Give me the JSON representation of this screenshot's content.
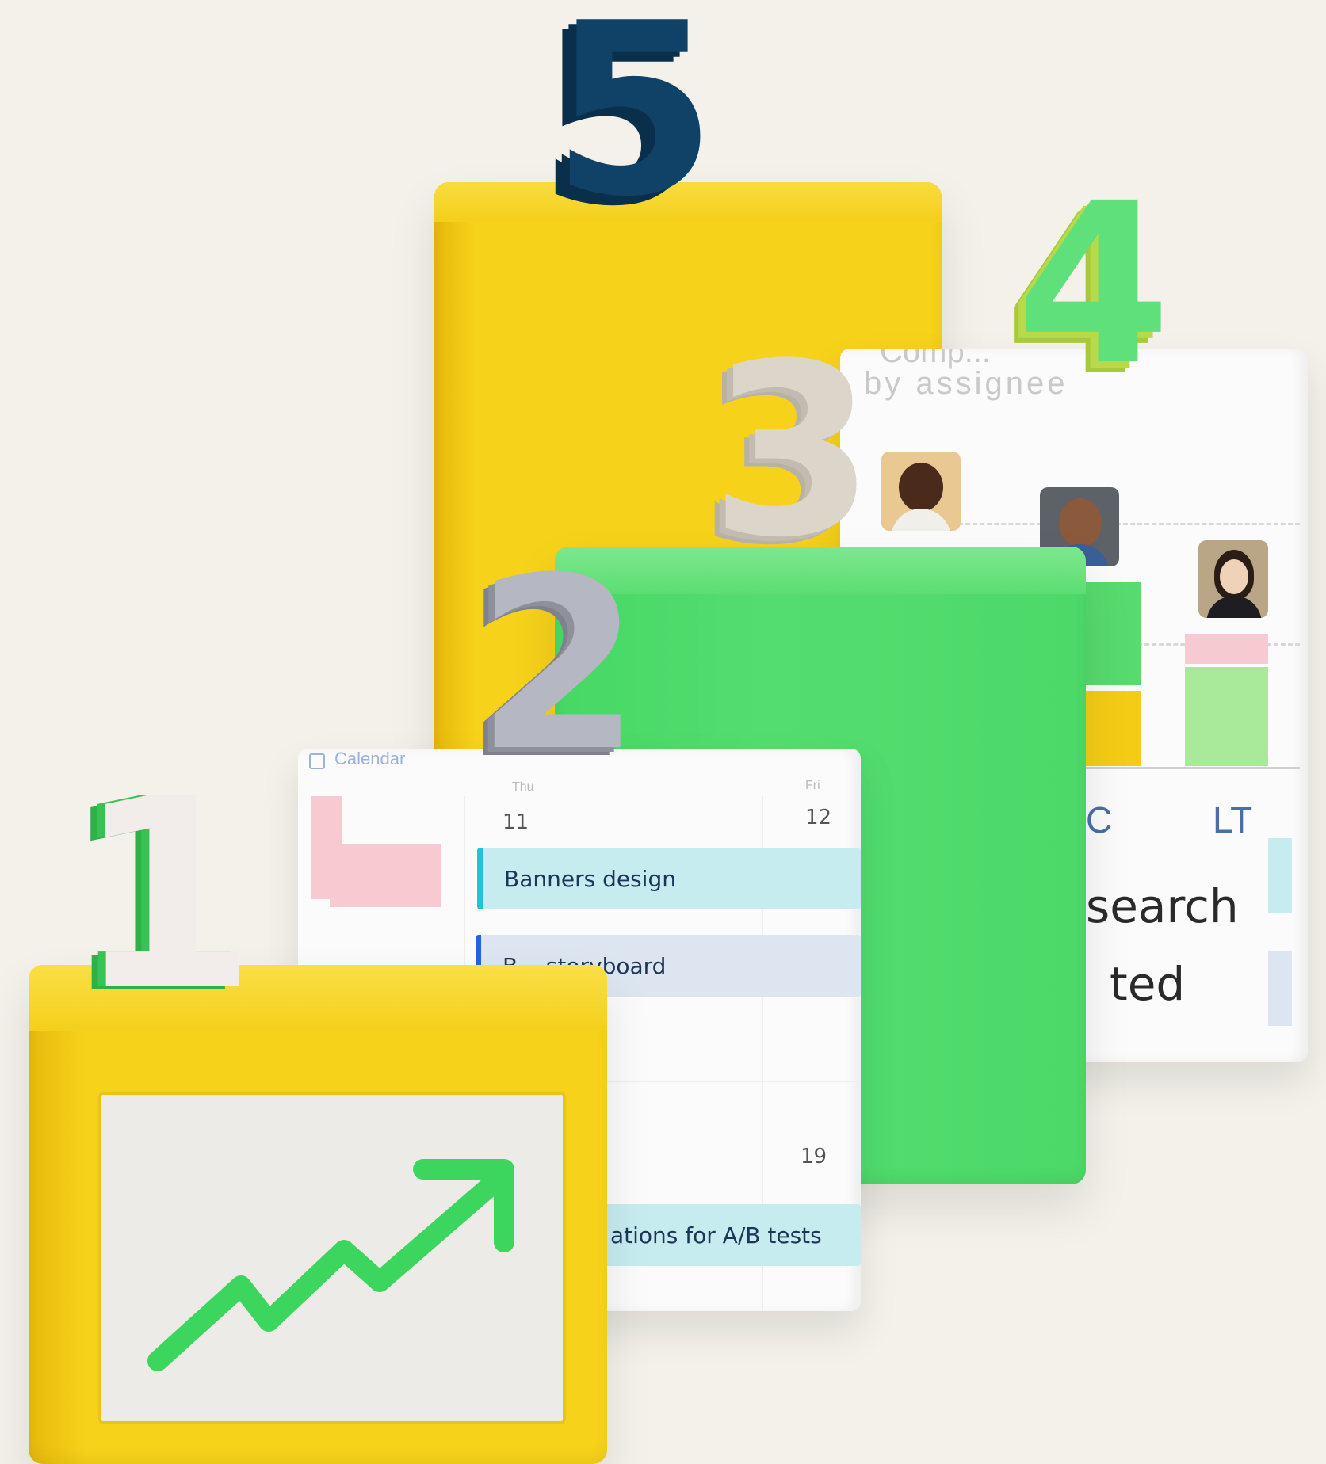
{
  "scene": {
    "background": "#f3f1ea",
    "digits": {
      "one": "1",
      "two": "2",
      "three": "3",
      "four": "4",
      "five": "5"
    },
    "colors": {
      "yellow": "#f4cc16",
      "green": "#4fdc6b",
      "navy": "#0f4266",
      "silver": "#a8aab5",
      "stone": "#dcd6ca",
      "mint": "#6fe07a"
    }
  },
  "calendar": {
    "title": "Calendar",
    "day_headers": [
      "Thu",
      "Fri"
    ],
    "dates": [
      "11",
      "12",
      "19"
    ],
    "events": [
      {
        "label": "Banners design",
        "color": "#c6ecef",
        "accent": "#22c3d6"
      },
      {
        "label": "Banner storyboard",
        "visible_label": "B... storyboard",
        "color": "#dde6f0",
        "accent": "#2463d9"
      },
      {
        "label": "ations for A/B tests",
        "color": "#c6ecef",
        "accent": "#22c3d6"
      }
    ]
  },
  "workload": {
    "title_line1": "Comp...",
    "title_line2": "by assignee",
    "initials": [
      "C",
      "LT"
    ],
    "text_fragments": [
      "search",
      "ted"
    ],
    "bar_colors": [
      "#52d96c",
      "#f4cc16",
      "#f7c9d1",
      "#a8e99a"
    ],
    "avatars": [
      "person-1-avatar",
      "person-2-avatar",
      "person-3-avatar"
    ]
  },
  "growth_panel": {
    "icon": "trending-up-arrow-icon"
  }
}
